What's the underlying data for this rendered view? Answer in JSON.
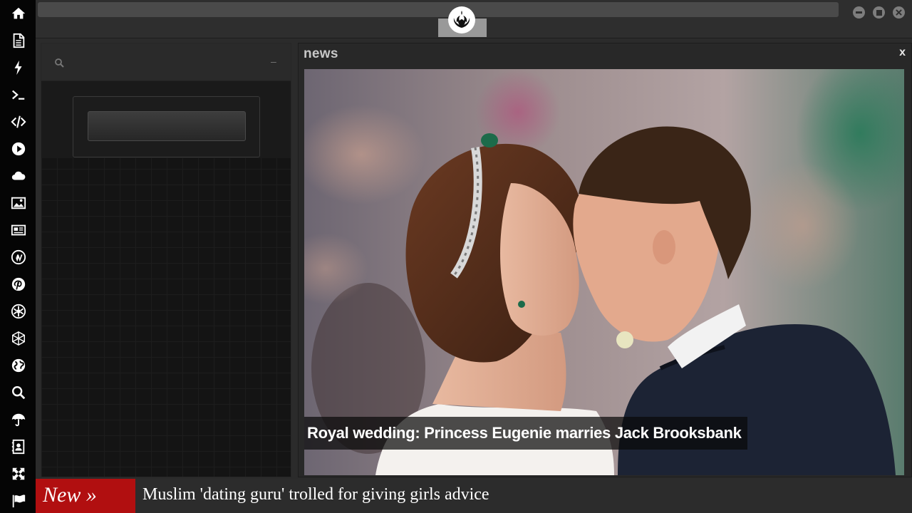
{
  "sidebar": {
    "icons": [
      "home-icon",
      "document-icon",
      "flash-icon",
      "terminal-icon",
      "code-icon",
      "play-icon",
      "cloud-icon",
      "image-icon",
      "newspaper-icon",
      "wordpress-icon",
      "pinterest-icon",
      "rebel-alliance-icon",
      "hexagon-network-icon",
      "globe-icon",
      "search-icon",
      "umbrella-icon",
      "contacts-icon",
      "expand-icon",
      "flag-icon"
    ]
  },
  "window": {
    "controls": [
      "minimize",
      "maximize",
      "close"
    ],
    "logo": "rebel-alliance-logo"
  },
  "left_panel": {
    "collapse_symbol": "–"
  },
  "news_panel": {
    "title": "news",
    "close_symbol": "x",
    "headline": "Royal wedding: Princess Eugenie marries Jack Brooksbank"
  },
  "ticker": {
    "badge": "New »",
    "text": "Muslim 'dating guru' trolled for giving girls advice"
  },
  "colors": {
    "rail_bg": "#050505",
    "panel_bg": "#141414",
    "ticker_badge": "#b10f10",
    "topbar": "#2e2e2e"
  }
}
